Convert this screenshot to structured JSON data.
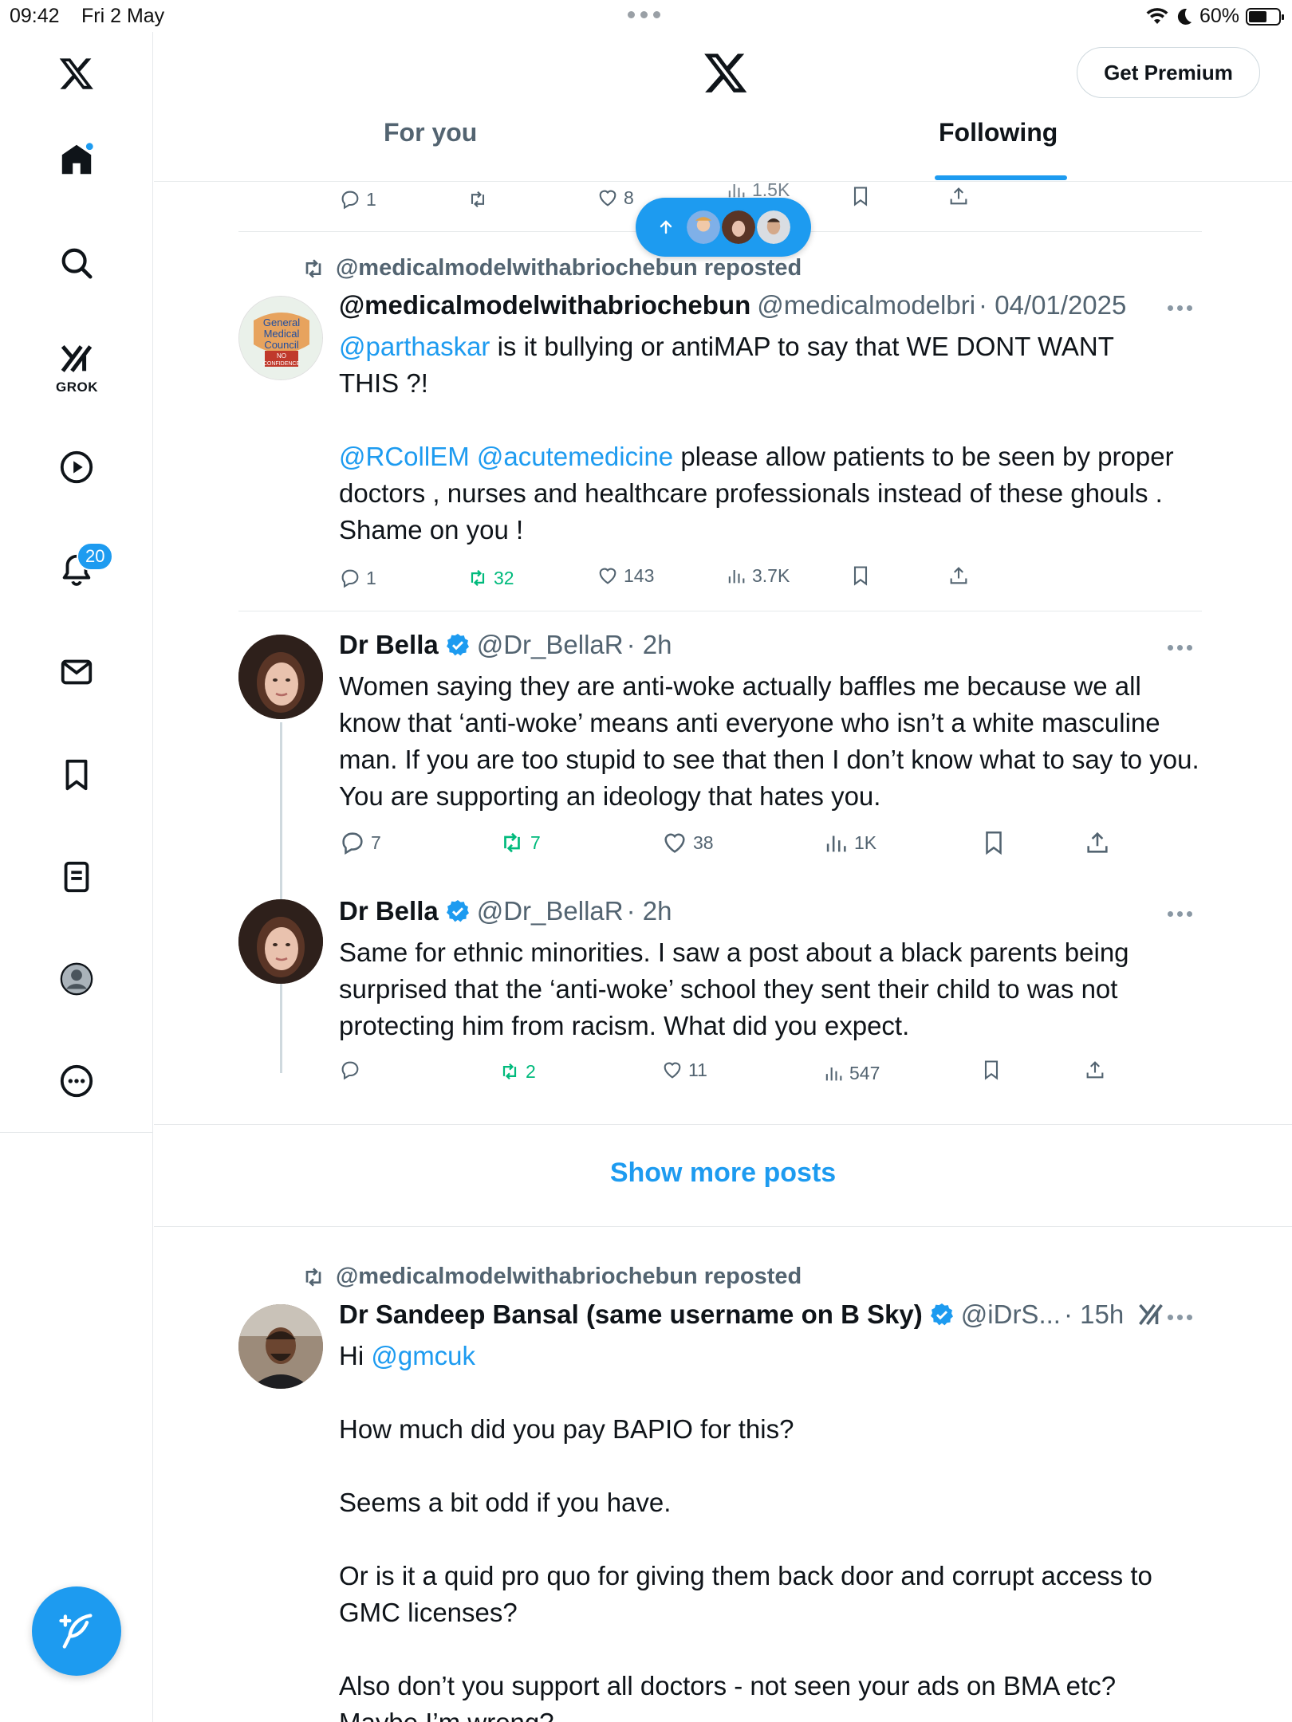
{
  "status_bar": {
    "time": "09:42",
    "date": "Fri 2 May",
    "battery": "60%",
    "battery_level": 0.6
  },
  "sidebar": {
    "grok_label": "GROK",
    "notifications_count": "20"
  },
  "header": {
    "premium_label": "Get Premium",
    "tabs": [
      {
        "label": "For you"
      },
      {
        "label": "Following"
      }
    ]
  },
  "top_post_actions": {
    "replies": "1",
    "likes": "8",
    "views": "1.5K"
  },
  "posts": [
    {
      "repost_label": "@medicalmodelwithabriochebun reposted",
      "name": "@medicalmodelwithabriochebun",
      "handle": "@medicalmodelbri",
      "time": "· 04/01/2025",
      "avatar_text": [
        "General",
        "Medical",
        "Council",
        "NO",
        "CONFIDENCE"
      ],
      "line1_mention": "@parthaskar",
      "line1_text": " is it bullying or antiMAP to say that WE DONT WANT",
      "line2_text": "THIS ?!",
      "mention2": "@RCollEM",
      "mention3": "@acutemedicine",
      "line3_text": " please allow patients to be seen by proper",
      "line4_text": "doctors , nurses and healthcare professionals instead of these ghouls .",
      "line5_text": "Shame on you !",
      "replies": "1",
      "reposts": "32",
      "likes": "143",
      "views": "3.7K"
    },
    {
      "name": "Dr Bella",
      "handle": "@Dr_BellaR",
      "time": "· 2h",
      "text": "Women saying they are anti-woke actually baffles me because we all know that ‘anti-woke’ means anti everyone who isn’t a white masculine man. If you are too stupid to see that then I don’t know what to say to you. You are supporting an ideology that hates you.",
      "replies": "7",
      "reposts": "7",
      "likes": "38",
      "views": "1K"
    },
    {
      "name": "Dr Bella",
      "handle": "@Dr_BellaR",
      "time": "· 2h",
      "text": "Same for ethnic minorities. I saw a post about a black parents being surprised that the ‘anti-woke’ school they sent their child to was not protecting him from racism. What did you expect.",
      "replies": "",
      "reposts": "2",
      "likes": "11",
      "views": "547"
    },
    {
      "repost_label": "@medicalmodelwithabriochebun reposted",
      "name": "Dr Sandeep Bansal (same username on B Sky)",
      "handle": "@iDrS...",
      "time": "· 15h",
      "greeting": "Hi ",
      "mention": "@gmcuk",
      "p1": "How much did you pay BAPIO for this?",
      "p2": "Seems a bit odd if you have.",
      "p3": "Or is it a quid pro quo for giving them back door and corrupt access to GMC licenses?",
      "p4": "Also don’t you support all doctors - not seen your ads on BMA etc?",
      "p5": "Maybe I’m wrong?"
    }
  ],
  "show_more": "Show more posts",
  "colors": {
    "accent": "#1d9bf0",
    "repost": "#00ba7c",
    "muted": "#536471",
    "text": "#0f1419"
  }
}
